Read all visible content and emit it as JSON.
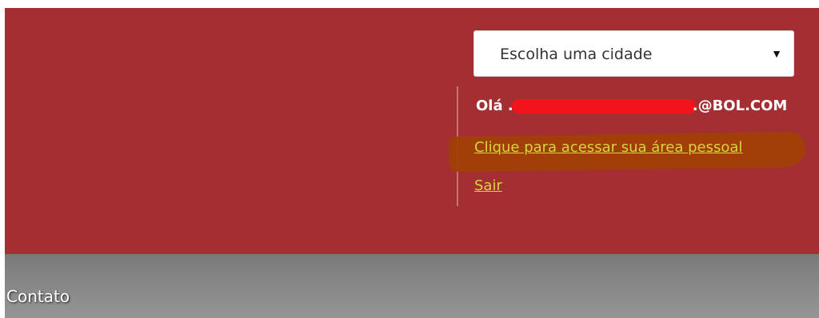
{
  "colors": {
    "header_background": "#a32f33",
    "link": "#d5d63c",
    "highlight": "#a23f05",
    "redaction": "#f2141a"
  },
  "city_select": {
    "selected": "Escolha uma cidade",
    "arrow_icon": "triangle-down-icon"
  },
  "user_panel": {
    "greeting_prefix": "Olá",
    "greeting_visible_start": ".",
    "email_domain": ".@BOL.COM",
    "personal_area_link": "Clique para acessar sua área pessoal",
    "logout_link": "Sair"
  },
  "footer": {
    "contact_label": "Contato"
  }
}
